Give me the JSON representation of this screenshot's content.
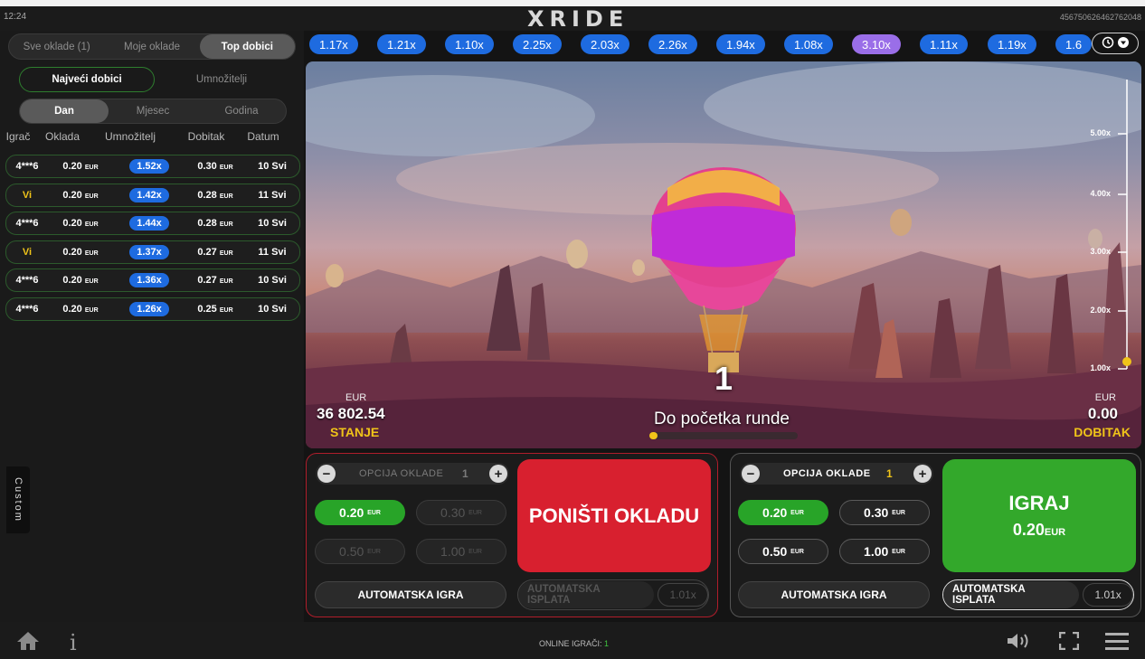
{
  "header": {
    "time": "12:24",
    "logo": "XRIDE",
    "round_id": "456750626462762048"
  },
  "bets_panel": {
    "tabs": [
      "Sve oklade (1)",
      "Moje oklade",
      "Top dobici"
    ],
    "active_tab": "Top dobici",
    "subtabs": [
      "Najveći dobici",
      "Umnožitelji"
    ],
    "active_subtab": "Najveći dobici",
    "periods": [
      "Dan",
      "Mjesec",
      "Godina"
    ],
    "active_period": "Dan",
    "columns": [
      "Igrač",
      "Oklada",
      "Umnožitelj",
      "Dobitak",
      "Datum"
    ],
    "rows": [
      {
        "player": "4***6",
        "bet": "0.20",
        "bet_cur": "EUR",
        "mult": "1.52x",
        "win": "0.30",
        "win_cur": "EUR",
        "date": "10 Svi"
      },
      {
        "player": "Vi",
        "bet": "0.20",
        "bet_cur": "EUR",
        "mult": "1.42x",
        "win": "0.28",
        "win_cur": "EUR",
        "date": "11 Svi"
      },
      {
        "player": "4***6",
        "bet": "0.20",
        "bet_cur": "EUR",
        "mult": "1.44x",
        "win": "0.28",
        "win_cur": "EUR",
        "date": "10 Svi"
      },
      {
        "player": "Vi",
        "bet": "0.20",
        "bet_cur": "EUR",
        "mult": "1.37x",
        "win": "0.27",
        "win_cur": "EUR",
        "date": "11 Svi"
      },
      {
        "player": "4***6",
        "bet": "0.20",
        "bet_cur": "EUR",
        "mult": "1.36x",
        "win": "0.27",
        "win_cur": "EUR",
        "date": "10 Svi"
      },
      {
        "player": "4***6",
        "bet": "0.20",
        "bet_cur": "EUR",
        "mult": "1.26x",
        "win": "0.25",
        "win_cur": "EUR",
        "date": "10 Svi"
      }
    ],
    "custom_tab": "Custom"
  },
  "history": {
    "multipliers": [
      "1.17x",
      "1.21x",
      "1.10x",
      "2.25x",
      "2.03x",
      "2.26x",
      "1.94x",
      "1.08x",
      "3.10x",
      "1.11x",
      "1.19x",
      "1.6"
    ],
    "highlight_color": "#9a6ee8",
    "default_color": "#1e6be0",
    "toggle_icons": [
      "history-clock-icon",
      "dropdown-triangle-icon"
    ]
  },
  "game": {
    "scale": [
      "5.00x",
      "4.00x",
      "3.00x",
      "2.00x",
      "1.00x"
    ],
    "countdown": "1",
    "message": "Do početka runde",
    "progress": 0.05,
    "balance_currency": "EUR",
    "balance": "36 802.54",
    "balance_label": "STANJE",
    "win_currency": "EUR",
    "win": "0.00",
    "win_label": "DOBITAK"
  },
  "bet1": {
    "option_label": "OPCIJA OKLADE",
    "option_num": "1",
    "amounts": [
      {
        "value": "0.20",
        "cur": "EUR"
      },
      {
        "value": "0.30",
        "cur": "EUR"
      },
      {
        "value": "0.50",
        "cur": "EUR"
      },
      {
        "value": "1.00",
        "cur": "EUR"
      }
    ],
    "cancel_label": "PONIŠTI OKLADU",
    "auto_play": "AUTOMATSKA IGRA",
    "auto_cashout": "AUTOMATSKA ISPLATA",
    "auto_cashout_value": "1.01x"
  },
  "bet2": {
    "option_label": "OPCIJA OKLADE",
    "option_num": "1",
    "amounts": [
      {
        "value": "0.20",
        "cur": "EUR"
      },
      {
        "value": "0.30",
        "cur": "EUR"
      },
      {
        "value": "0.50",
        "cur": "EUR"
      },
      {
        "value": "1.00",
        "cur": "EUR"
      }
    ],
    "play_label": "IGRAJ",
    "play_amount": "0.20",
    "play_currency": "EUR",
    "auto_play": "AUTOMATSKA IGRA",
    "auto_cashout": "AUTOMATSKA ISPLATA",
    "auto_cashout_value": "1.01x"
  },
  "footer": {
    "online_label": "ONLINE IGRAČI:",
    "online_count": "1"
  }
}
